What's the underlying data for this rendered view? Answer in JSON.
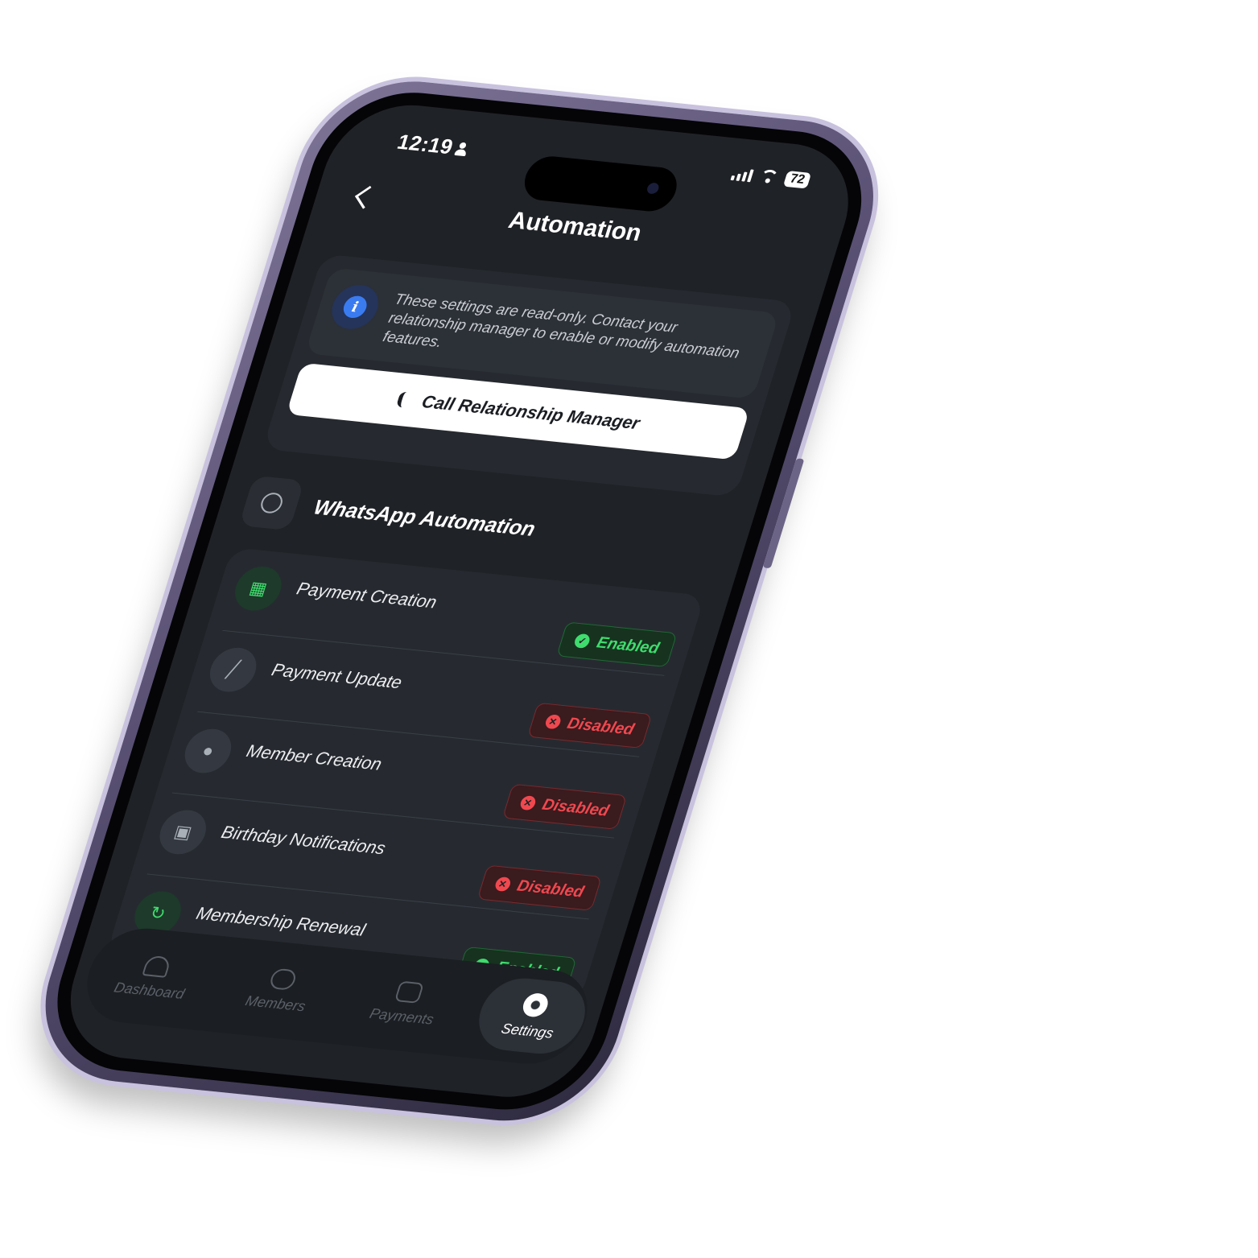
{
  "status_bar": {
    "time": "12:19",
    "battery": "72"
  },
  "header": {
    "title": "Automation"
  },
  "info": {
    "message": "These settings are read-only. Contact your relationship manager to enable or modify automation features.",
    "call_button_label": "Call Relationship Manager"
  },
  "section": {
    "title": "WhatsApp Automation"
  },
  "automations": [
    {
      "label": "Payment Creation",
      "status": "Enabled",
      "icon": "money-icon"
    },
    {
      "label": "Payment Update",
      "status": "Disabled",
      "icon": "pencil-icon"
    },
    {
      "label": "Member Creation",
      "status": "Disabled",
      "icon": "add-user-icon"
    },
    {
      "label": "Birthday Notifications",
      "status": "Disabled",
      "icon": "gift-icon"
    },
    {
      "label": "Membership Renewal",
      "status": "Enabled",
      "icon": "refresh-icon"
    }
  ],
  "tabs": [
    {
      "label": "Dashboard",
      "icon": "speedometer-icon"
    },
    {
      "label": "Members",
      "icon": "users-icon"
    },
    {
      "label": "Payments",
      "icon": "wallet-icon"
    },
    {
      "label": "Settings",
      "icon": "gear-icon",
      "active": true
    }
  ],
  "colors": {
    "enabled": "#3fdc6e",
    "disabled": "#f0484f",
    "screen_bg": "#1f2226",
    "card_bg": "#262a30",
    "frame": "#5b5276"
  }
}
